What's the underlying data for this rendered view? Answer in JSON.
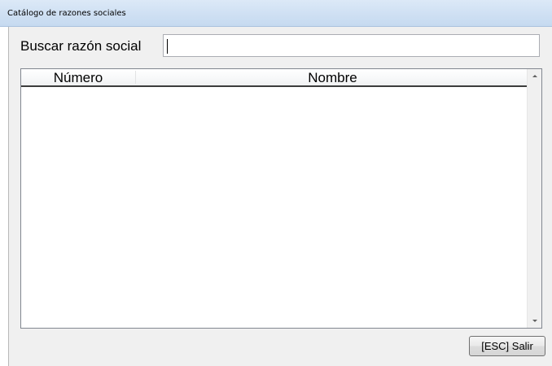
{
  "window": {
    "title": "Catálogo de razones sociales"
  },
  "search": {
    "label": "Buscar razón social",
    "value": "",
    "placeholder": ""
  },
  "table": {
    "columns": [
      "Número",
      "Nombre"
    ],
    "rows": []
  },
  "footer": {
    "exit_label": "[ESC] Salir"
  }
}
